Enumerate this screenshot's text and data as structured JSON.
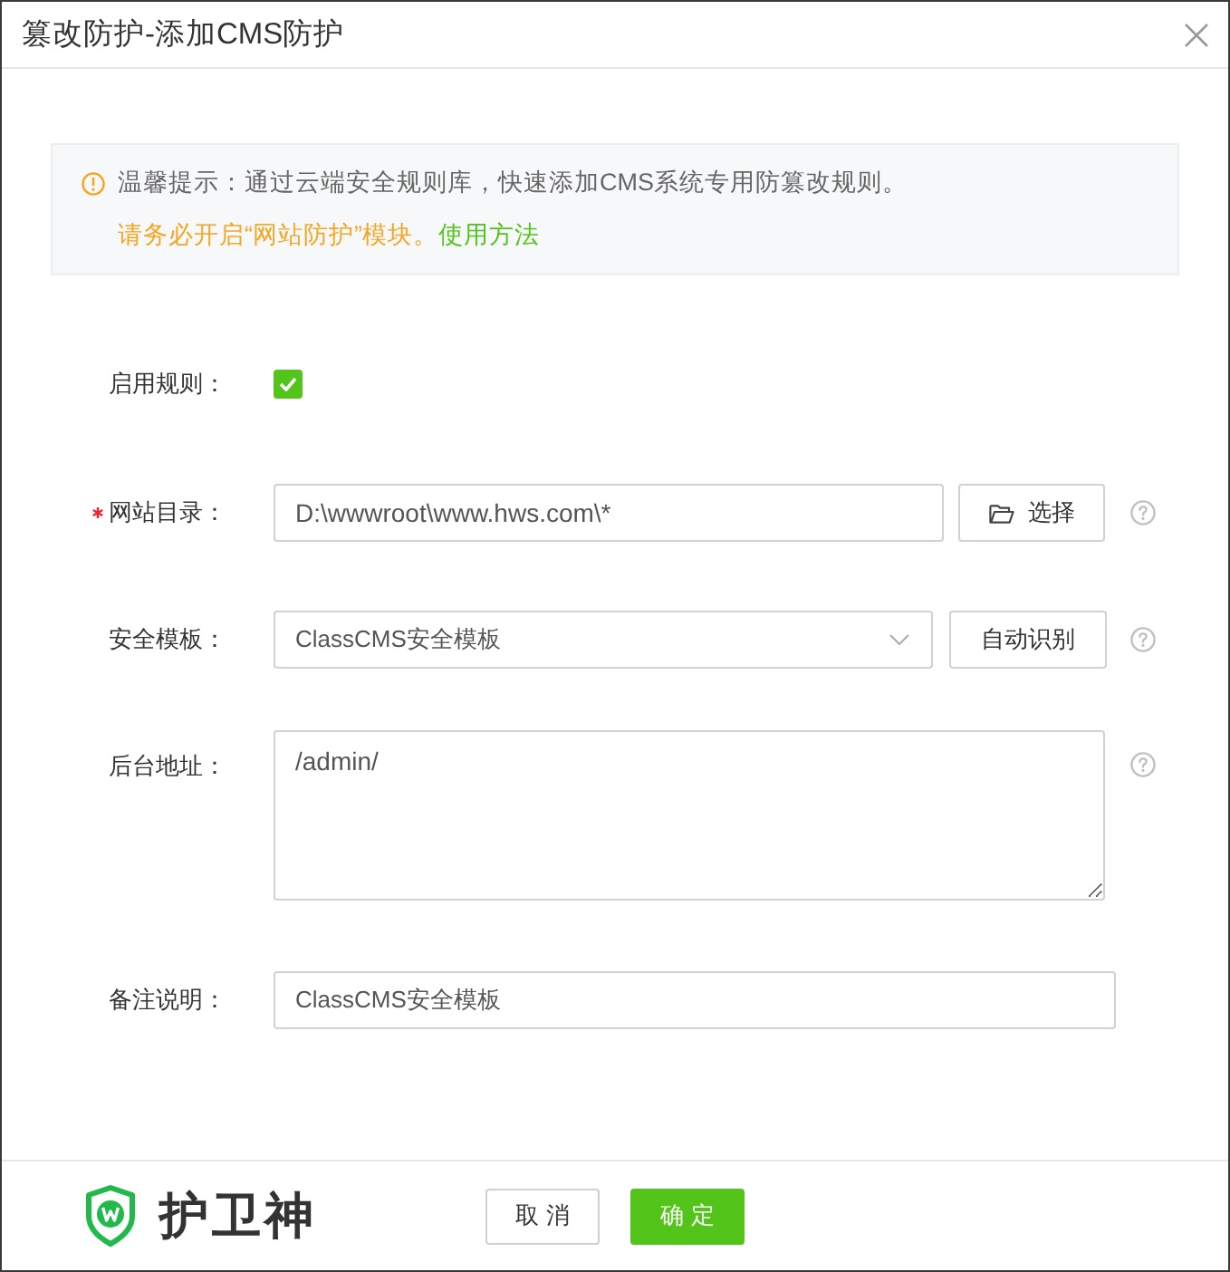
{
  "dialog": {
    "title": "篡改防护-添加CMS防护"
  },
  "notice": {
    "tip": "温馨提示：通过云端安全规则库，快速添加CMS系统专用防篡改规则。",
    "warning": "请务必开启“网站防护”模块。",
    "link": "使用方法"
  },
  "form": [
    {
      "kind": "checkbox",
      "label": "启用规则：",
      "required": false,
      "checked": true
    },
    {
      "kind": "path",
      "label": "网站目录：",
      "required": true,
      "value": "D:\\wwwroot\\www.hws.com\\*",
      "button": "选择",
      "help": true
    },
    {
      "kind": "select",
      "label": "安全模板：",
      "required": false,
      "value": "ClassCMS安全模板",
      "button": "自动识别",
      "help": true
    },
    {
      "kind": "textarea",
      "label": "后台地址：",
      "required": false,
      "value": "/admin/",
      "help": true
    },
    {
      "kind": "text",
      "label": "备注说明：",
      "required": false,
      "value": "ClassCMS安全模板",
      "help": false
    }
  ],
  "footer": {
    "brand": "护卫神",
    "buttons": [
      {
        "label": "取 消",
        "kind": "default"
      },
      {
        "label": "确 定",
        "kind": "primary"
      }
    ]
  }
}
